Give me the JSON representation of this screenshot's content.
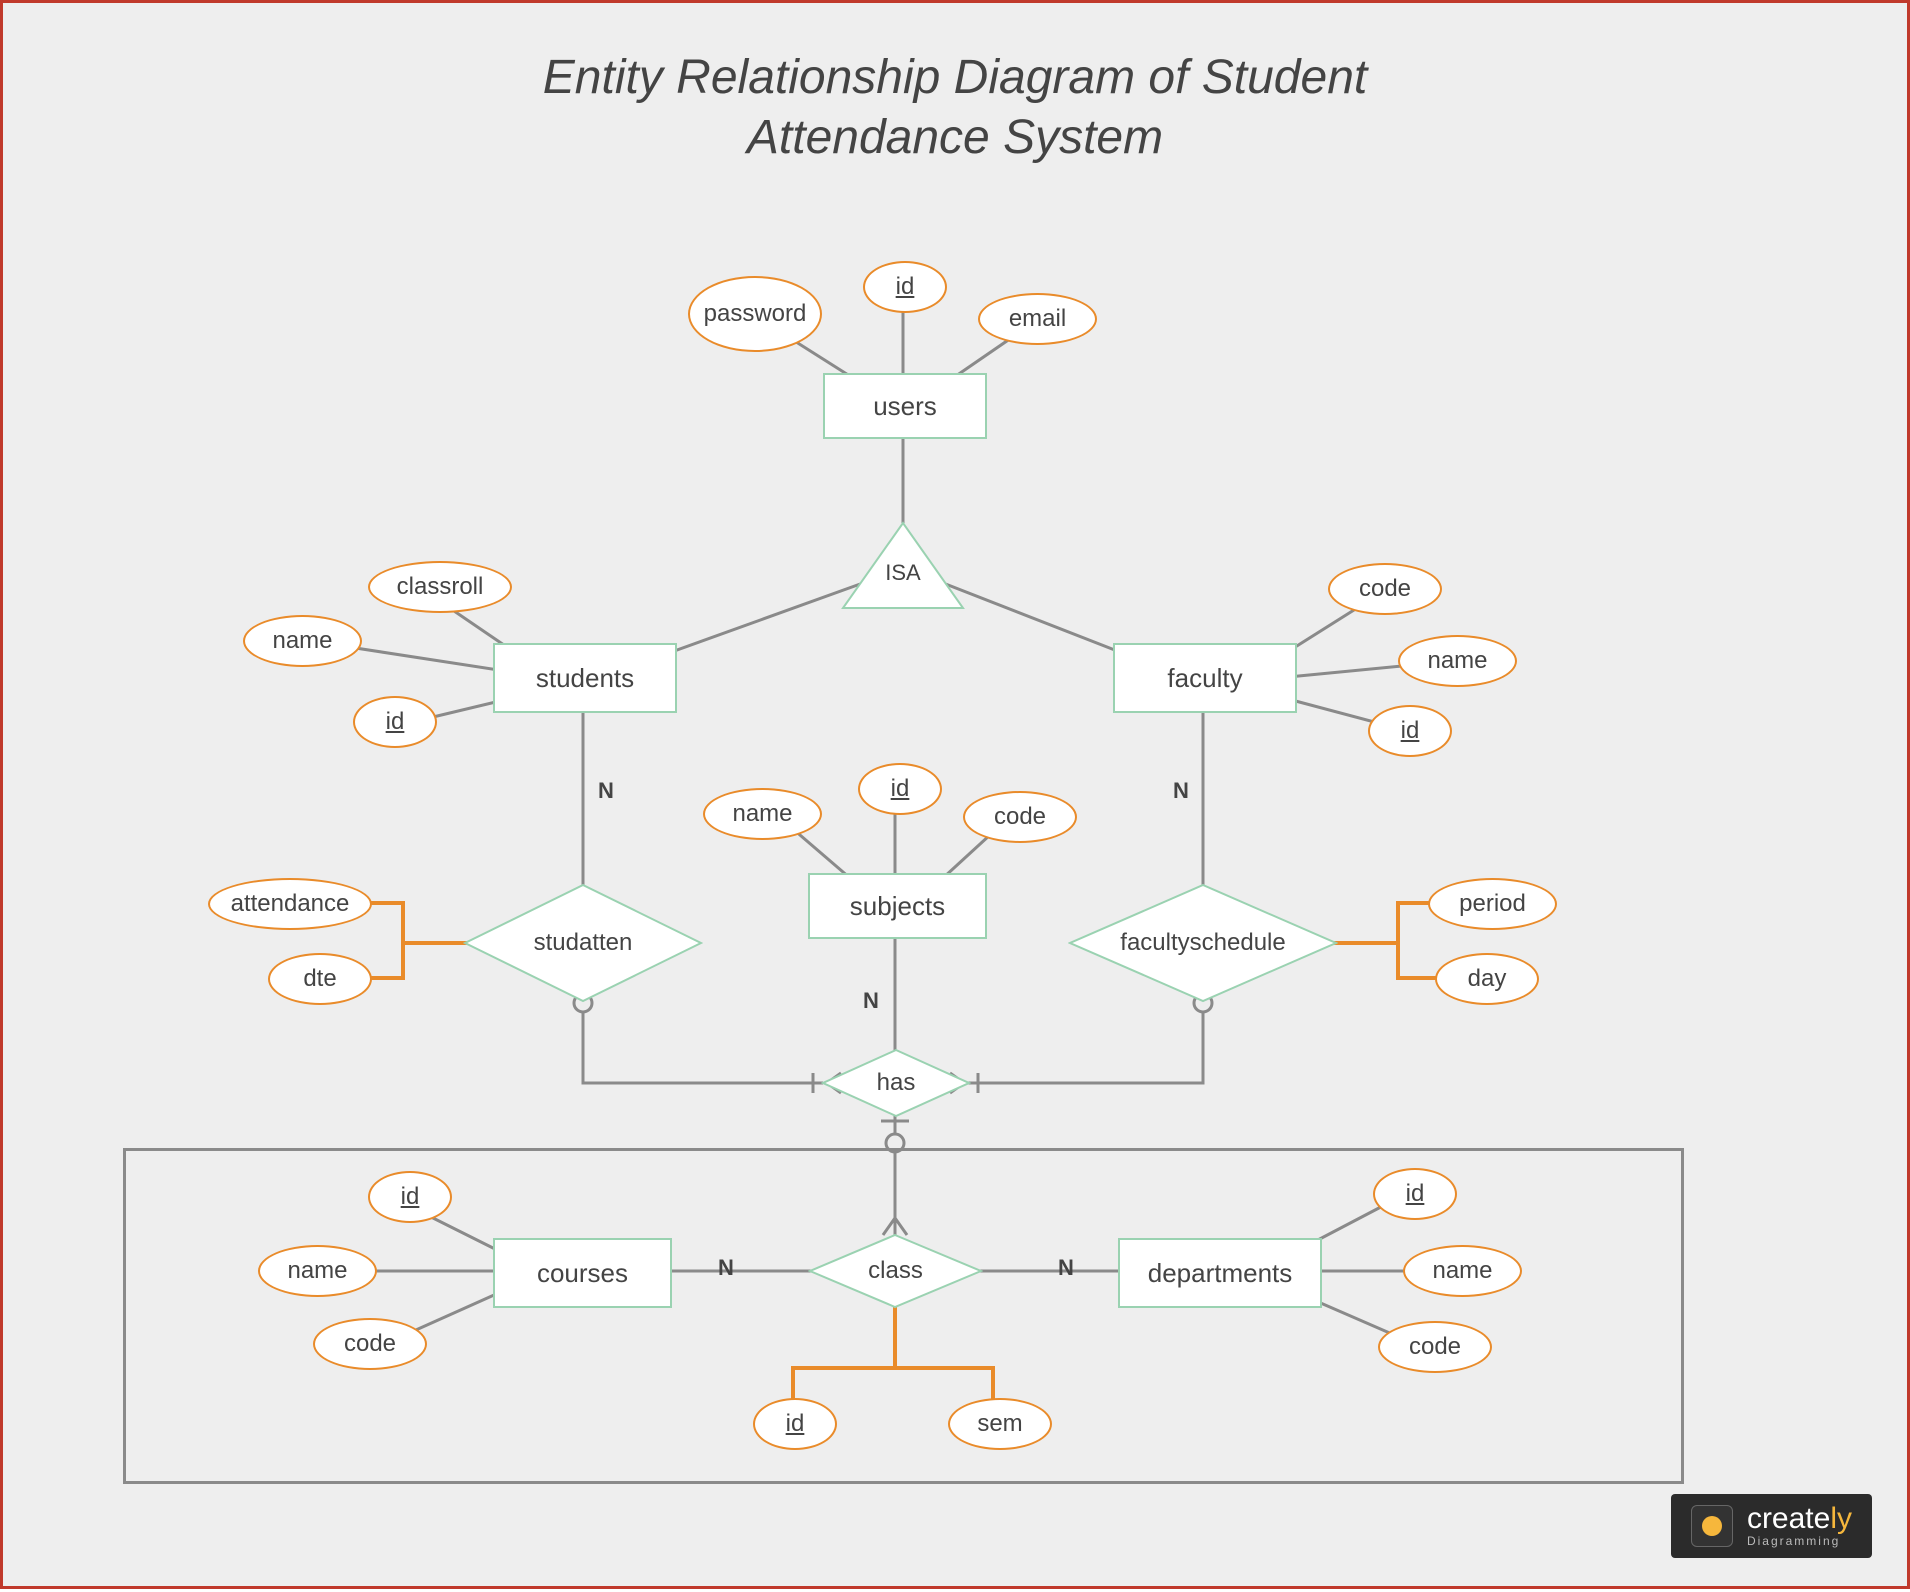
{
  "title_line1": "Entity Relationship Diagram of Student",
  "title_line2": "Attendance System",
  "entities": {
    "users": "users",
    "students": "students",
    "faculty": "faculty",
    "subjects": "subjects",
    "courses": "courses",
    "departments": "departments"
  },
  "relationships": {
    "isa": "ISA",
    "studatten": "studatten",
    "facultyschedule": "facultyschedule",
    "has": "has",
    "class": "class"
  },
  "attributes": {
    "users": {
      "password": "password",
      "id": "id",
      "email": "email"
    },
    "students": {
      "name": "name",
      "classroll": "classroll",
      "id": "id"
    },
    "faculty": {
      "code": "code",
      "name": "name",
      "id": "id"
    },
    "subjects": {
      "name": "name",
      "id": "id",
      "code": "code"
    },
    "studatten": {
      "attendance": "attendance",
      "dte": "dte"
    },
    "facultyschedule": {
      "period": "period",
      "day": "day"
    },
    "courses": {
      "id": "id",
      "name": "name",
      "code": "code"
    },
    "departments": {
      "id": "id",
      "name": "name",
      "code": "code"
    },
    "class": {
      "id": "id",
      "sem": "sem"
    }
  },
  "cardinalities": {
    "students_studatten": "N",
    "faculty_facultyschedule": "N",
    "subjects_has": "N",
    "courses_class": "N",
    "departments_class": "N"
  },
  "logo": {
    "brand": "create",
    "suffix": "ly",
    "tagline": "Diagramming"
  }
}
